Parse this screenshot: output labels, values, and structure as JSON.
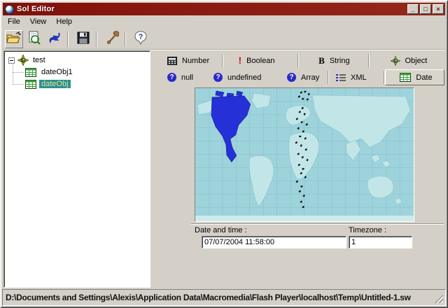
{
  "window": {
    "title": "Sol Editor",
    "buttons": {
      "minimize": "_",
      "maximize": "□",
      "close": "×"
    }
  },
  "menu": {
    "items": [
      "File",
      "View",
      "Help"
    ]
  },
  "toolbar": {
    "buttons": [
      "open-file",
      "preview",
      "refresh",
      "save",
      "tools",
      "help"
    ]
  },
  "tree": {
    "root_label": "test",
    "children": [
      {
        "label": "dateObj1",
        "selected": false
      },
      {
        "label": "dateObj",
        "selected": true
      }
    ]
  },
  "tabs": {
    "row1": [
      {
        "label": "Number",
        "icon": "calculator-icon"
      },
      {
        "label": "Boolean",
        "icon": "exclamation-icon"
      },
      {
        "label": "String",
        "icon": "bold-b-icon"
      },
      {
        "label": "Object",
        "icon": "object-star-icon"
      }
    ],
    "row2": [
      {
        "label": "null",
        "icon": "question-icon"
      },
      {
        "label": "undefined",
        "icon": "question-icon"
      },
      {
        "label": "Array",
        "icon": "question-icon"
      },
      {
        "label": "XML",
        "icon": "list-icon"
      },
      {
        "label": "Date",
        "icon": "table-icon",
        "selected": true
      }
    ]
  },
  "map": {
    "description": "world timezone map",
    "highlighted_region": "North America / GMT-8..-6 zone"
  },
  "date_panel": {
    "datetime_label": "Date and time :",
    "datetime_value": "07/07/2004 11:58:00",
    "timezone_label": "Timezone :",
    "timezone_value": "1"
  },
  "statusbar": {
    "path": "D:\\Documents and Settings\\Alexis\\Application Data\\Macromedia\\Flash Player\\localhost\\Temp\\Untitled-1.sw"
  },
  "colors": {
    "titlebar": "#8c140c",
    "chrome": "#d4d0c8",
    "tree_selection": "#2e8f8f",
    "map_ocean": "#9fd3db",
    "map_land": "#c2e6e8",
    "map_highlight": "#2531d6"
  }
}
